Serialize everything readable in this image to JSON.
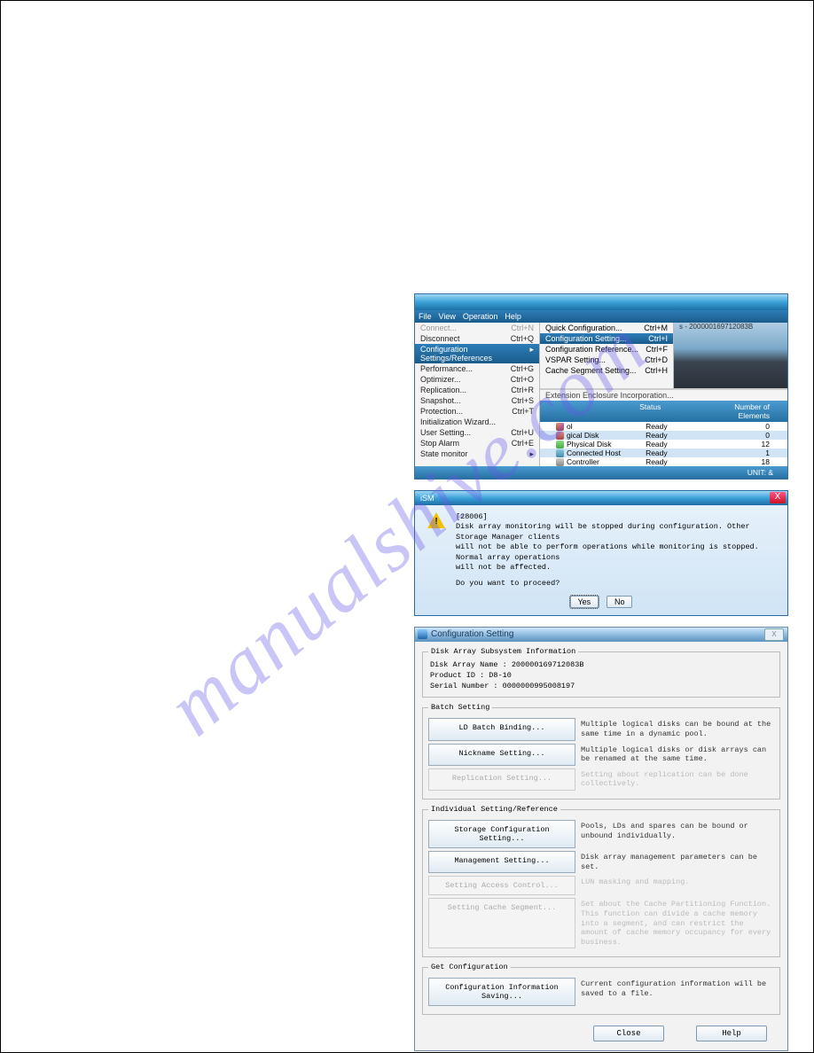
{
  "watermark": "manualshive.com",
  "win1": {
    "menubar": [
      "File",
      "View",
      "Operation",
      "Help"
    ],
    "menu": [
      {
        "label": "Connect...",
        "shortcut": "Ctrl+N",
        "dim": true
      },
      {
        "label": "Disconnect",
        "shortcut": "Ctrl+Q"
      },
      {
        "label": "Configuration Settings/References",
        "shortcut": "",
        "sel": true,
        "arrow": "▸"
      },
      {
        "label": "Performance...",
        "shortcut": "Ctrl+G"
      },
      {
        "label": "Optimizer...",
        "shortcut": "Ctrl+O"
      },
      {
        "label": "Replication...",
        "shortcut": "Ctrl+R"
      },
      {
        "label": "Snapshot...",
        "shortcut": "Ctrl+S"
      },
      {
        "label": "Protection...",
        "shortcut": "Ctrl+T"
      },
      {
        "label": "Initialization Wizard...",
        "shortcut": ""
      },
      {
        "label": "User Setting...",
        "shortcut": "Ctrl+U"
      },
      {
        "label": "Stop Alarm",
        "shortcut": "Ctrl+E"
      },
      {
        "label": "State monitor",
        "shortcut": "",
        "arrow": "▸"
      }
    ],
    "submenu": [
      {
        "label": "Quick Configuration...",
        "shortcut": "Ctrl+M"
      },
      {
        "label": "Configuration Setting...",
        "shortcut": "Ctrl+I",
        "sel": true
      },
      {
        "label": "Configuration Reference...",
        "shortcut": "Ctrl+F"
      },
      {
        "label": "VSPAR Setting...",
        "shortcut": "Ctrl+D"
      },
      {
        "label": "Cache Segment Setting...",
        "shortcut": "Ctrl+H"
      }
    ],
    "extender": "Extension Enclosure Incorporation...",
    "right_pane_text": "s - 200000169712083B",
    "thead": [
      "",
      "Status",
      "Number of Elements"
    ],
    "rows": [
      {
        "ico": "ico-disk",
        "name": "ol",
        "status": "Ready",
        "n": "0"
      },
      {
        "ico": "ico-disk",
        "name": "gical Disk",
        "status": "Ready",
        "n": "0",
        "sel": true
      },
      {
        "ico": "ico-pd",
        "name": "Physical Disk",
        "status": "Ready",
        "n": "12"
      },
      {
        "ico": "ico-host",
        "name": "Connected Host",
        "status": "Ready",
        "n": "1",
        "sel": true
      },
      {
        "ico": "ico-ctrl",
        "name": "Controller",
        "status": "Ready",
        "n": "18"
      }
    ],
    "footer": "UNIT:    &"
  },
  "win2": {
    "title": "iSM",
    "code": "[28006]",
    "msg1": "Disk array monitoring will be stopped during configuration. Other Storage Manager clients",
    "msg2": "will not be able to perform operations while monitoring is stopped. Normal array operations",
    "msg3": "will not be affected.",
    "msg4": "Do you want to proceed?",
    "yes": "Yes",
    "no": "No"
  },
  "win3": {
    "title": "Configuration Setting",
    "group_info": "Disk Array Subsystem Information",
    "info": [
      "Disk Array Name : 200000169712083B",
      "Product ID      : D8-10",
      "Serial Number   : 0000000995008197"
    ],
    "group_batch": "Batch Setting",
    "batch": [
      {
        "btn": "LD Batch Binding...",
        "desc": "Multiple logical disks can be bound at the same time in a dynamic pool."
      },
      {
        "btn": "Nickname Setting...",
        "desc": "Multiple logical disks or disk arrays can be renamed at the same time."
      },
      {
        "btn": "Replication Setting...",
        "desc": "Setting about replication can be done collectively.",
        "disabled": true
      }
    ],
    "group_ind": "Individual Setting/Reference",
    "ind": [
      {
        "btn": "Storage Configuration Setting...",
        "desc": "Pools, LDs and spares can be bound or unbound individually."
      },
      {
        "btn": "Management Setting...",
        "desc": "Disk array management parameters can be set."
      },
      {
        "btn": "Setting Access Control...",
        "desc": "LUN masking and mapping.",
        "disabled": true
      },
      {
        "btn": "Setting Cache Segment...",
        "desc": "Set about the Cache Partitioning Function. This function can divide a cache memory into a segment, and can restrict the amount of cache memory occupancy for every business.",
        "disabled": true
      }
    ],
    "group_get": "Get Configuration",
    "get": [
      {
        "btn": "Configuration Information Saving...",
        "desc": "Current configuration information will be saved to a file."
      }
    ],
    "close": "Close",
    "help": "Help"
  }
}
